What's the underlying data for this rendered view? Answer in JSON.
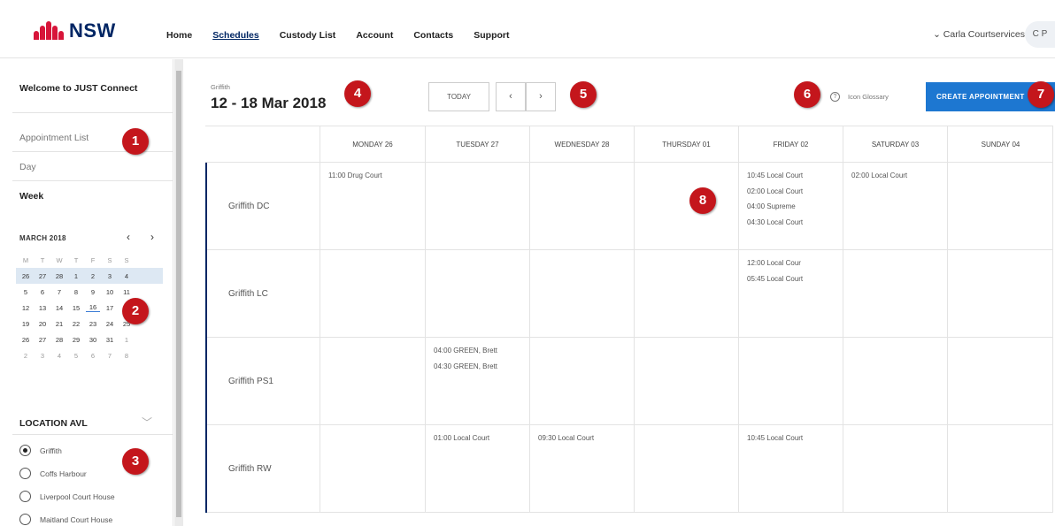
{
  "header": {
    "logo_text": "NSW",
    "nav": [
      "Home",
      "Schedules",
      "Custody List",
      "Account",
      "Contacts",
      "Support"
    ],
    "active_nav": "Schedules",
    "user_name": "Carla Courtservices",
    "user_initials": "C P"
  },
  "sidebar": {
    "welcome": "Welcome to JUST Connect",
    "links": {
      "appointment_list": "Appointment List",
      "day": "Day",
      "week": "Week"
    },
    "calendar": {
      "month_label": "MARCH 2018",
      "weekdays": [
        "M",
        "T",
        "W",
        "T",
        "F",
        "S",
        "S"
      ],
      "weeks": [
        [
          "26",
          "27",
          "28",
          "1",
          "2",
          "3",
          "4"
        ],
        [
          "5",
          "6",
          "7",
          "8",
          "9",
          "10",
          "11"
        ],
        [
          "12",
          "13",
          "14",
          "15",
          "16",
          "17",
          "18"
        ],
        [
          "19",
          "20",
          "21",
          "22",
          "23",
          "24",
          "25"
        ],
        [
          "26",
          "27",
          "28",
          "29",
          "30",
          "31",
          "1"
        ],
        [
          "2",
          "3",
          "4",
          "5",
          "6",
          "7",
          "8"
        ]
      ],
      "highlighted_week_index": 0,
      "today": "16"
    },
    "location_heading": "LOCATION AVL",
    "locations": [
      "Griffith",
      "Coffs Harbour",
      "Liverpool Court House",
      "Maitland Court House"
    ],
    "selected_location": "Griffith"
  },
  "main": {
    "location": "Griffith",
    "date_range": "12 - 18 Mar 2018",
    "today_button": "TODAY",
    "prev_icon": "‹",
    "next_icon": "›",
    "glossary_label": "Icon Glossary",
    "create_button": "CREATE APPOINTMENT",
    "days": [
      "MONDAY 26",
      "TUESDAY 27",
      "WEDNESDAY 28",
      "THURSDAY 01",
      "FRIDAY 02",
      "SATURDAY 03",
      "SUNDAY 04"
    ],
    "rows": [
      {
        "label": "Griffith DC",
        "cells": [
          [
            "11:00  Drug Court"
          ],
          [],
          [],
          [],
          [
            "10:45  Local Court",
            "02:00  Local Court",
            "04:00  Supreme",
            "04:30  Local Court"
          ],
          [
            "02:00  Local Court"
          ],
          []
        ]
      },
      {
        "label": "Griffith LC",
        "cells": [
          [],
          [],
          [],
          [],
          [
            "12:00  Local Cour",
            "05:45  Local Court"
          ],
          [],
          []
        ]
      },
      {
        "label": "Griffith PS1",
        "cells": [
          [],
          [
            "04:00  GREEN, Brett",
            "04:30  GREEN, Brett"
          ],
          [],
          [],
          [],
          [],
          []
        ]
      },
      {
        "label": "Griffith RW",
        "cells": [
          [],
          [
            "01:00  Local Court"
          ],
          [
            "09:30  Local Court"
          ],
          [],
          [
            "10:45  Local Court"
          ],
          [],
          []
        ]
      }
    ]
  },
  "callouts": [
    "1",
    "2",
    "3",
    "4",
    "5",
    "6",
    "7",
    "8"
  ],
  "colors": {
    "brand_red": "#d7153a",
    "navy": "#002664",
    "primary_blue": "#1d77d1",
    "callout_red": "#c4161c",
    "week_highlight": "#dde8f3"
  }
}
